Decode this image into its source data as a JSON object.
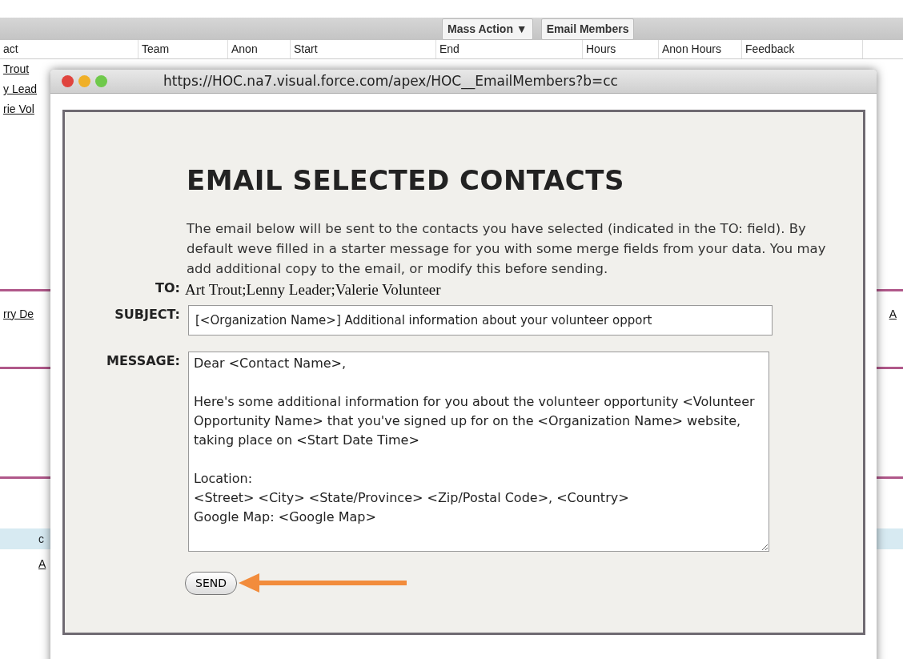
{
  "background": {
    "toolbar_buttons": [
      "Mass Action ▼",
      "Email Members"
    ],
    "columns": [
      "act",
      "Team",
      "Anon",
      "Start",
      "End",
      "Hours",
      "Anon Hours",
      "Feedback"
    ],
    "top_links": [
      "Trout",
      "y Lead",
      "rie Vol"
    ],
    "middle_link": "rry De",
    "right_link": "A",
    "lower_left": [
      "c",
      "A"
    ]
  },
  "popup": {
    "url": "https://HOC.na7.visual.force.com/apex/HOC__EmailMembers?b=cc",
    "heading": "EMAIL SELECTED CONTACTS",
    "intro": "The email below will be sent to the contacts you have selected (indicated in the TO: field). By default weve filled in a starter message for you with some merge fields from your data. You may add additional copy to the email, or modify this before sending.",
    "to_label": "TO:",
    "to_value": "Art Trout;Lenny Leader;Valerie Volunteer",
    "subject_label": "SUBJECT:",
    "subject_value": "[<Organization Name>] Additional information about your volunteer opport",
    "message_label": "MESSAGE:",
    "message_value": "Dear <Contact Name>,\n\nHere's some additional information for you about the volunteer opportunity <Volunteer Opportunity Name> that you've signed up for on the <Organization Name> website, taking place on <Start Date Time>\n\nLocation:\n<Street> <City> <State/Province> <Zip/Postal Code>, <Country>\nGoogle Map: <Google Map>",
    "send_button": "SEND"
  }
}
